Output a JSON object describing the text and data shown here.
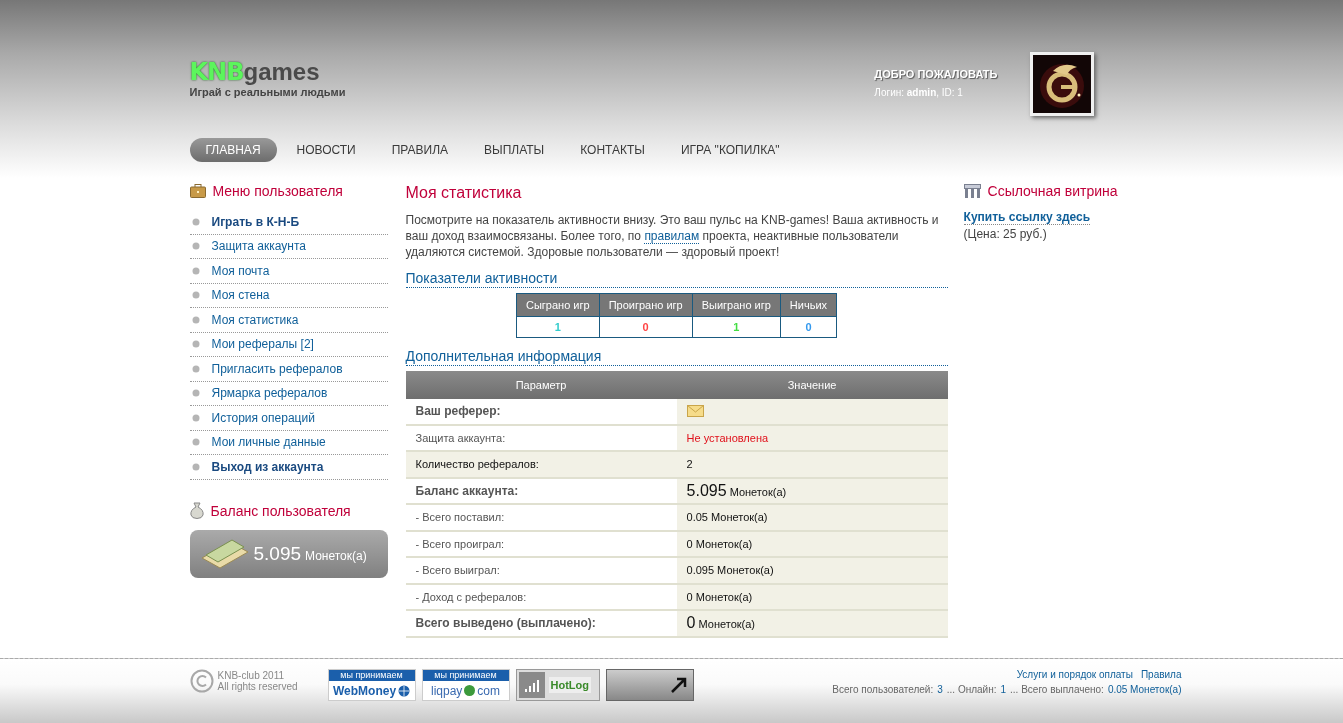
{
  "header": {
    "logo": {
      "brand": "KNB",
      "suffix": "games",
      "tagline": "Играй с реальными людьми"
    },
    "welcome": {
      "title": "ДОБРО ПОЖАЛОВАТЬ",
      "login": "Логин: **admin**, ID: 1"
    }
  },
  "nav": [
    {
      "label": "ГЛАВНАЯ",
      "selected": true
    },
    {
      "label": "НОВОСТИ",
      "selected": false
    },
    {
      "label": "ПРАВИЛА",
      "selected": false
    },
    {
      "label": "ВЫПЛАТЫ",
      "selected": false
    },
    {
      "label": "КОНТАКТЫ",
      "selected": false
    },
    {
      "label": "ИГРА \"КОПИЛКА\"",
      "selected": false
    }
  ],
  "user_menu": {
    "title": "Меню пользователя",
    "items": [
      {
        "label": "Играть в К-Н-Б",
        "bold": true
      },
      {
        "label": "Защита аккаунта",
        "bold": false
      },
      {
        "label": "Моя почта",
        "bold": false
      },
      {
        "label": "Моя стена",
        "bold": false
      },
      {
        "label": "Моя статистика",
        "bold": false
      },
      {
        "label": "Мои рефералы [2]",
        "bold": false
      },
      {
        "label": "Пригласить рефералов",
        "bold": false
      },
      {
        "label": "Ярмарка рефералов",
        "bold": false
      },
      {
        "label": "История операций",
        "bold": false
      },
      {
        "label": "Мои личные данные",
        "bold": false
      },
      {
        "label": "Выход из аккаунта",
        "bold": true
      }
    ]
  },
  "balance": {
    "title": "Баланс пользователя",
    "amount": "5.095",
    "unit": "Монеток(а)"
  },
  "main": {
    "title": "Моя статистика",
    "intro": {
      "before": "Посмотрите на показатель активности внизу. Это ваш пульс на KNB-games! Ваша активность и ваш доход взаимосвязаны. Более того, по",
      "link": "правилам",
      "after": "проекта, неактивные пользователи удаляются системой. Здоровые пользователи — здоровый проект!"
    },
    "activity": {
      "title": "Показатели активности",
      "columns": [
        {
          "label": "Сыграно игр",
          "value": "1",
          "color": "#33cccc"
        },
        {
          "label": "Проиграно игр",
          "value": "0",
          "color": "#ff4444"
        },
        {
          "label": "Выиграно игр",
          "value": "1",
          "color": "#44dd44"
        },
        {
          "label": "Ничьих",
          "value": "0",
          "color": "#3399ee"
        }
      ]
    },
    "extra": {
      "title": "Дополнительная информация",
      "columns": [
        "Параметр",
        "Значение"
      ],
      "rows": [
        {
          "param": "Ваш реферер:",
          "bold": true,
          "dim": true,
          "kind": "icon",
          "highlighted": false
        },
        {
          "param": "Защита аккаунта:",
          "bold": false,
          "dim": true,
          "kind": "alert",
          "value": "Не установлена",
          "highlighted": false
        },
        {
          "param": "Количество рефералов:",
          "bold": false,
          "dim": false,
          "kind": "text",
          "value": "2",
          "highlighted": true
        },
        {
          "param": "Баланс аккаунта:",
          "bold": true,
          "dim": true,
          "kind": "amount",
          "value": "5.095",
          "unit": "Монеток(а)",
          "highlighted": false
        },
        {
          "param": "- Всего поставил:",
          "bold": false,
          "dim": true,
          "kind": "text",
          "value": "0.05 Монеток(а)",
          "highlighted": false
        },
        {
          "param": "- Всего проиграл:",
          "bold": false,
          "dim": true,
          "kind": "text",
          "value": "0 Монеток(а)",
          "highlighted": false
        },
        {
          "param": "- Всего выиграл:",
          "bold": false,
          "dim": true,
          "kind": "text",
          "value": "0.095 Монеток(а)",
          "highlighted": false
        },
        {
          "param": "- Доход с рефералов:",
          "bold": false,
          "dim": true,
          "kind": "text",
          "value": "0 Монеток(а)",
          "highlighted": false
        },
        {
          "param": "Всего выведено (выплачено):",
          "bold": true,
          "dim": true,
          "kind": "amount",
          "value": "0",
          "unit": "Монеток(а)",
          "highlighted": false
        }
      ]
    }
  },
  "link_showcase": {
    "title": "Ссылочная витрина",
    "link": "Купить ссылку здесь",
    "price": "(Цена: 25 руб.)"
  },
  "footer": {
    "copyright": [
      "KNB-club 2011",
      "All rights reserved"
    ],
    "badges": [
      {
        "kind": "webmoney",
        "caption": "мы принимаем",
        "name": "WebMoney"
      },
      {
        "kind": "liqpay",
        "caption": "мы принимаем",
        "name": "liqpay",
        "suffix": "com"
      },
      {
        "kind": "hotlog",
        "name": "HotLog"
      },
      {
        "kind": "arrow"
      }
    ],
    "links": [
      "Услуги и порядок оплаты",
      "Правила"
    ],
    "stats": [
      {
        "label": "Всего пользователей:",
        "value": "3"
      },
      {
        "label": "... Онлайн:",
        "value": "1"
      },
      {
        "label": "... Всего выплачено:",
        "value": "0.05 Монеток(а)"
      }
    ]
  }
}
